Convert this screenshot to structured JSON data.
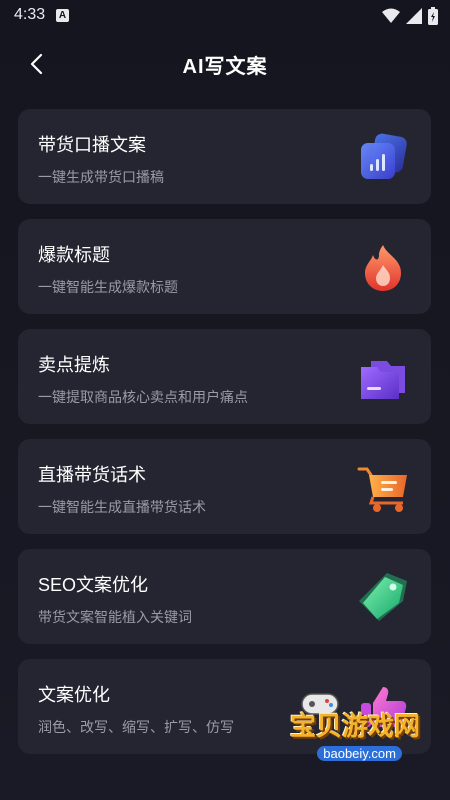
{
  "status_bar": {
    "time": "4:33",
    "notification_letter": "A"
  },
  "header": {
    "title": "AI写文案"
  },
  "cards": [
    {
      "title": "带货口播文案",
      "subtitle": "一键生成带货口播稿",
      "icon": "chart-cards-icon"
    },
    {
      "title": "爆款标题",
      "subtitle": "一键智能生成爆款标题",
      "icon": "flame-icon"
    },
    {
      "title": "卖点提炼",
      "subtitle": "一键提取商品核心卖点和用户痛点",
      "icon": "folder-icon"
    },
    {
      "title": "直播带货话术",
      "subtitle": "一键智能生成直播带货话术",
      "icon": "shopping-cart-icon"
    },
    {
      "title": "SEO文案优化",
      "subtitle": "带货文案智能植入关键词",
      "icon": "tag-icon"
    },
    {
      "title": "文案优化",
      "subtitle": "润色、改写、缩写、扩写、仿写",
      "icon": "thumbs-up-icon"
    }
  ],
  "watermark": {
    "name": "宝贝游戏网",
    "url": "baobeiy.com"
  },
  "colors": {
    "background": "#15151f",
    "card": "#252532",
    "subtitle": "#9a9aa8"
  }
}
